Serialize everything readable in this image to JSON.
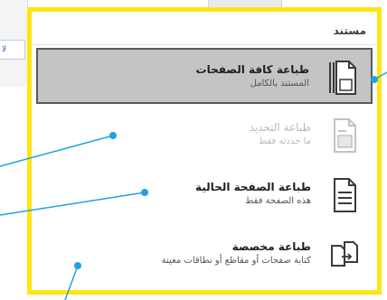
{
  "background": {
    "fragment_text": "لا"
  },
  "panel": {
    "header": "مستند",
    "frame_color": "#ffe516",
    "items": [
      {
        "title": "طباعة كافة الصفحات",
        "subtitle": "المستند بالكامل",
        "icon": "document-stack-icon",
        "state": "selected"
      },
      {
        "title": "طباعة التحديد",
        "subtitle": "ما حددته فقط",
        "icon": "document-selection-icon",
        "state": "disabled"
      },
      {
        "title": "طباعة الصفحة الحالية",
        "subtitle": "هذه الصفحة فقط",
        "icon": "document-page-icon",
        "state": "normal"
      },
      {
        "title": "طباعة مخصصة",
        "subtitle": "كتابة صفحات أو مقاطع أو نطاقات معينة",
        "icon": "custom-pages-icon",
        "state": "normal"
      }
    ]
  },
  "callout_color": "#1fa3e0"
}
